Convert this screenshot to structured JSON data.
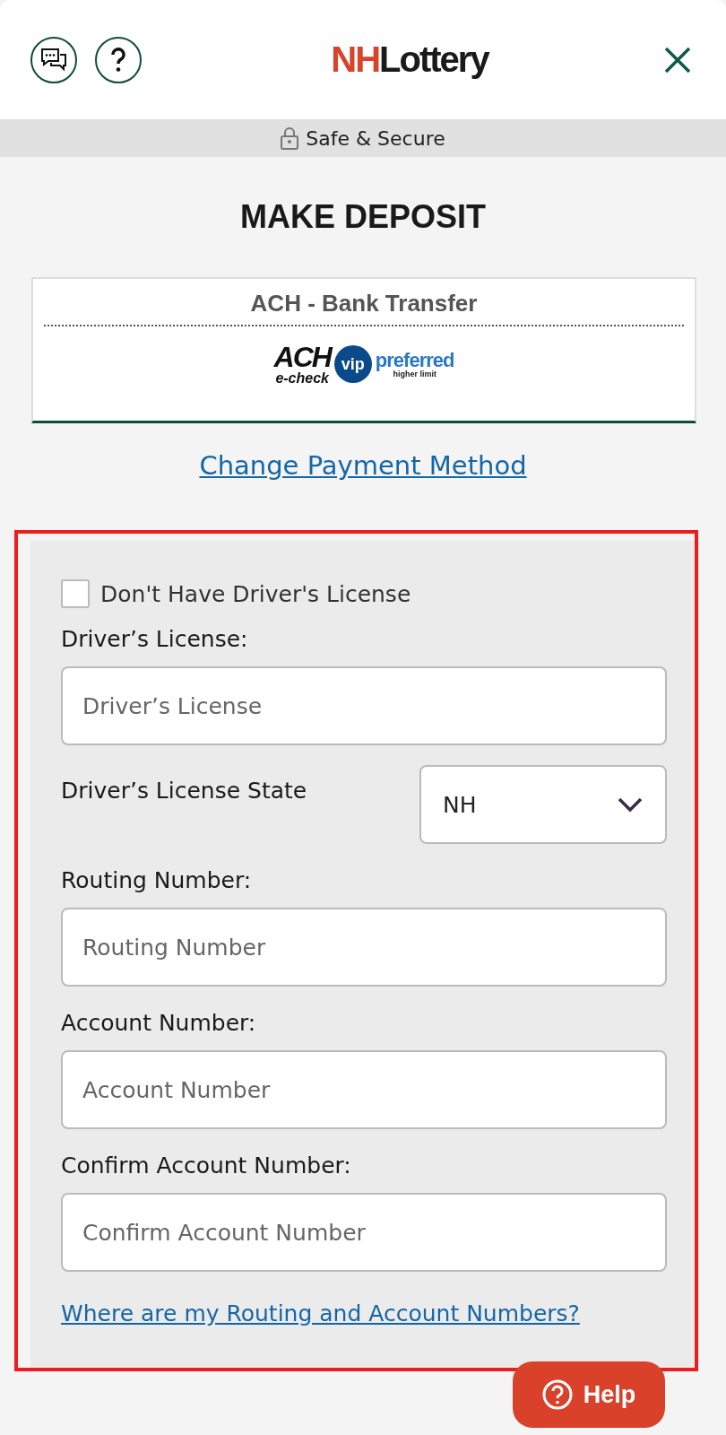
{
  "header": {
    "logo": {
      "part_1": "NH",
      "part_2": "Lottery"
    }
  },
  "secure_bar": {
    "label": "Safe & Secure"
  },
  "title": "MAKE DEPOSIT",
  "payment_method": {
    "name": "ACH - Bank Transfer",
    "badge": {
      "ach": "ACH",
      "echeck": "e-check",
      "vip": "vip",
      "preferred": "preferred",
      "limit": "higher limit"
    }
  },
  "change_link": "Change Payment Method",
  "form": {
    "no_license": {
      "label": "Don't Have Driver's License",
      "checked": false
    },
    "fields": [
      {
        "kind": "text",
        "label": "Driver’s License:",
        "placeholder": "Driver’s License"
      },
      {
        "kind": "select",
        "label": "Driver’s License State",
        "value": "NH"
      },
      {
        "kind": "text",
        "label": "Routing Number:",
        "placeholder": "Routing Number"
      },
      {
        "kind": "text",
        "label": "Account Number:",
        "placeholder": "Account Number"
      },
      {
        "kind": "text",
        "label": "Confirm Account Number:",
        "placeholder": "Confirm Account Number"
      }
    ],
    "help_link": "Where are my Routing and Account Numbers?"
  },
  "help_button": {
    "label": "Help"
  }
}
